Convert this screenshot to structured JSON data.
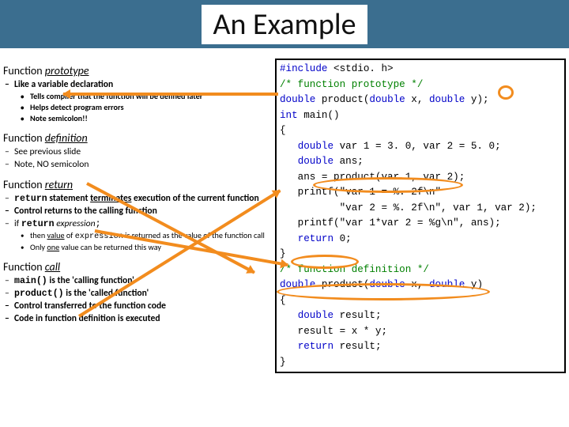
{
  "title": "An Example",
  "left": {
    "sec1": {
      "heading_a": "Function ",
      "heading_b": "prototype",
      "l1": [
        {
          "text": "Like a variable declaration",
          "bold": true,
          "l2": [
            "Tells compiler that the function will be defined later",
            "Helps detect program errors",
            "Note semicolon!!"
          ]
        }
      ]
    },
    "sec2": {
      "heading_a": "Function ",
      "heading_b": "definition",
      "l1": [
        {
          "text": "See previous slide"
        },
        {
          "text": "Note, NO semicolon"
        }
      ]
    },
    "sec3": {
      "heading_a": "Function ",
      "heading_b": "return",
      "l1": [
        {
          "html": "<span class='mono bold'>return</span><span class='bold'> statement </span><span class='bold uline2'>terminates</span><span class='bold'> execution of the current function</span>"
        },
        {
          "text": "Control returns to the calling function",
          "bold": true
        },
        {
          "html": "if <span class='mono bold'>return</span> <span style='font-style:italic'>expression</span><span class='mono'>;</span>",
          "l2": [
            {
              "html": "then <span class='uline2'>value</span> of <span class='mono'>expression</span> is returned as the value of the function call"
            },
            {
              "html": "Only <span class='uline2'>one</span> value can be returned this way"
            }
          ]
        }
      ]
    },
    "sec4": {
      "heading_a": "Function ",
      "heading_b": "call",
      "l1": [
        {
          "html": "<span class='mono bold'>main()</span><span class='bold'> is the 'calling function'</span>"
        },
        {
          "html": "<span class='mono bold'>product()</span><span class='bold'> is the 'called function'</span>"
        },
        {
          "text": "Control transferred to the function code",
          "bold": true
        },
        {
          "text": "Code in function definition is executed",
          "bold": true
        }
      ]
    }
  },
  "code": {
    "l01a": "#include",
    "l01b": " <stdio. h>",
    "l02": "/* function prototype */",
    "l03a": "double",
    "l03b": " product(",
    "l03c": "double",
    "l03d": " x, ",
    "l03e": "double",
    "l03f": " y);",
    "l04a": "int",
    "l04b": " main()",
    "l05": "{",
    "l06a": "   ",
    "l06b": "double",
    "l06c": " var 1 = 3. 0, var 2 = 5. 0;",
    "l07a": "   ",
    "l07b": "double",
    "l07c": " ans;",
    "l08": "   ans = product(var 1, var 2);",
    "l09": "   printf(\"var 1 = %. 2f\\n\"",
    "l10": "          \"var 2 = %. 2f\\n\", var 1, var 2);",
    "l11": "   printf(\"var 1*var 2 = %g\\n\", ans);",
    "l12a": "   ",
    "l12b": "return",
    "l12c": " 0;",
    "l13": "}",
    "l14": "/* function definition */",
    "l15a": "double",
    "l15b": " product(",
    "l15c": "double",
    "l15d": " x, ",
    "l15e": "double",
    "l15f": " y)",
    "l16": "{",
    "l17a": "   ",
    "l17b": "double",
    "l17c": " result;",
    "l18": "   result = x * y;",
    "l19a": "   ",
    "l19b": "return",
    "l19c": " result;",
    "l20": "}"
  }
}
